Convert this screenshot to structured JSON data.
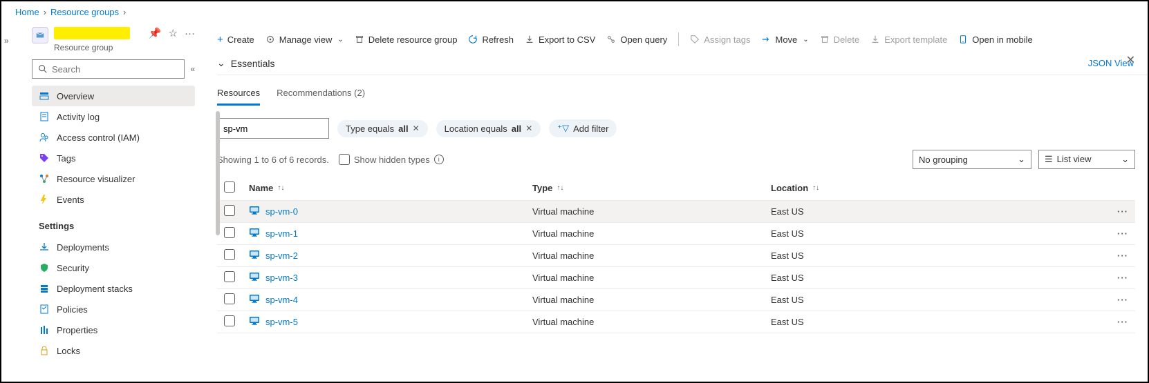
{
  "breadcrumb": {
    "home": "Home",
    "rg": "Resource groups"
  },
  "rg": {
    "subtitle": "Resource group"
  },
  "sidebar": {
    "search_placeholder": "Search",
    "items": [
      {
        "icon": "overview",
        "label": "Overview",
        "selected": true
      },
      {
        "icon": "activity",
        "label": "Activity log"
      },
      {
        "icon": "iam",
        "label": "Access control (IAM)"
      },
      {
        "icon": "tags",
        "label": "Tags"
      },
      {
        "icon": "visualizer",
        "label": "Resource visualizer"
      },
      {
        "icon": "events",
        "label": "Events"
      }
    ],
    "settings_heading": "Settings",
    "settings": [
      {
        "icon": "deployments",
        "label": "Deployments"
      },
      {
        "icon": "security",
        "label": "Security"
      },
      {
        "icon": "stacks",
        "label": "Deployment stacks"
      },
      {
        "icon": "policies",
        "label": "Policies"
      },
      {
        "icon": "properties",
        "label": "Properties"
      },
      {
        "icon": "locks",
        "label": "Locks"
      }
    ]
  },
  "toolbar": {
    "create": "Create",
    "manage_view": "Manage view",
    "delete_rg": "Delete resource group",
    "refresh": "Refresh",
    "export_csv": "Export to CSV",
    "open_query": "Open query",
    "assign_tags": "Assign tags",
    "move": "Move",
    "delete": "Delete",
    "export_template": "Export template",
    "open_mobile": "Open in mobile"
  },
  "essentials": {
    "label": "Essentials",
    "json_view": "JSON View"
  },
  "tabs": {
    "resources": "Resources",
    "recs": "Recommendations (2)"
  },
  "filter": {
    "value": "sp-vm",
    "type_chip_prefix": "Type equals ",
    "type_chip_value": "all",
    "loc_chip_prefix": "Location equals ",
    "loc_chip_value": "all",
    "add_filter": "Add filter"
  },
  "meta": {
    "showing": "Showing 1 to 6 of 6 records.",
    "show_hidden": "Show hidden types",
    "grouping": "No grouping",
    "view": "List view"
  },
  "columns": {
    "name": "Name",
    "type": "Type",
    "location": "Location"
  },
  "rows": [
    {
      "name": "sp-vm-0",
      "type": "Virtual machine",
      "location": "East US"
    },
    {
      "name": "sp-vm-1",
      "type": "Virtual machine",
      "location": "East US"
    },
    {
      "name": "sp-vm-2",
      "type": "Virtual machine",
      "location": "East US"
    },
    {
      "name": "sp-vm-3",
      "type": "Virtual machine",
      "location": "East US"
    },
    {
      "name": "sp-vm-4",
      "type": "Virtual machine",
      "location": "East US"
    },
    {
      "name": "sp-vm-5",
      "type": "Virtual machine",
      "location": "East US"
    }
  ]
}
